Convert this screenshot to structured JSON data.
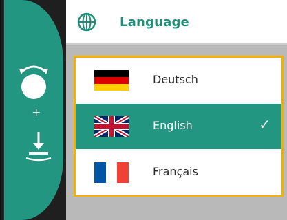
{
  "header": {
    "icon": "globe-icon",
    "title": "Language"
  },
  "bezel": {
    "knob_icon": "rotary-knob-icon",
    "plus_label": "+",
    "press_icon": "press-down-icon"
  },
  "languages": [
    {
      "label": "Deutsch",
      "flag": "german-flag-icon",
      "selected": false
    },
    {
      "label": "English",
      "flag": "uk-flag-icon",
      "selected": true
    },
    {
      "label": "Français",
      "flag": "french-flag-icon",
      "selected": false
    }
  ],
  "selected_mark": "✓",
  "colors": {
    "accent_green": "#229680",
    "focus_frame": "#f4b000",
    "display_bg": "#b9b9b9",
    "bezel_dark": "#1f1f1f"
  }
}
